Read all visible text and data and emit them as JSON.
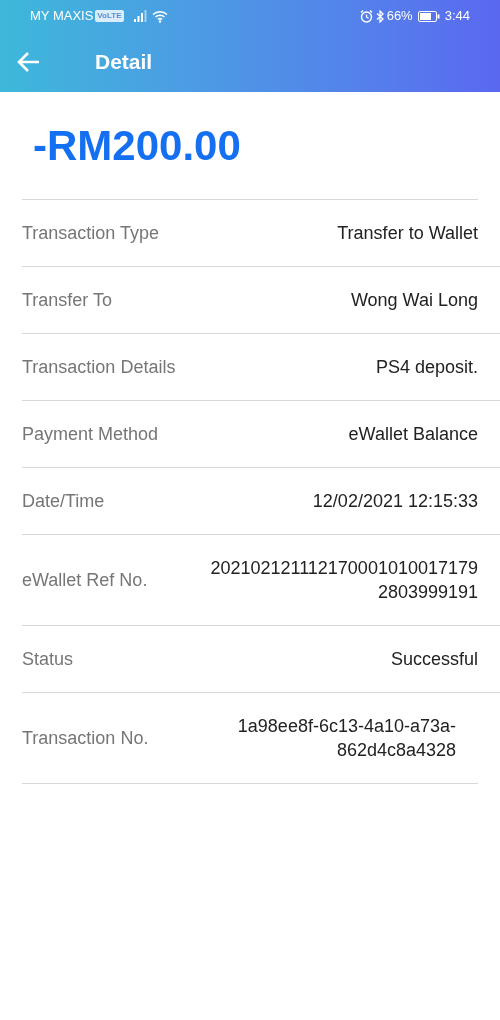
{
  "status_bar": {
    "carrier": "MY MAXIS",
    "network_badge": "VoLTE",
    "battery_percent": "66%",
    "time": "3:44"
  },
  "app_bar": {
    "title": "Detail"
  },
  "amount": "-RM200.00",
  "details": [
    {
      "label": "Transaction Type",
      "value": [
        "Transfer to Wallet"
      ]
    },
    {
      "label": "Transfer To",
      "value": [
        "Wong Wai Long"
      ]
    },
    {
      "label": "Transaction Details",
      "value": [
        "PS4 deposit."
      ]
    },
    {
      "label": "Payment Method",
      "value": [
        "eWallet Balance"
      ]
    },
    {
      "label": "Date/Time",
      "value": [
        "12/02/2021 12:15:33"
      ]
    },
    {
      "label": "eWallet Ref No.",
      "value": [
        "202102121112170001010017179",
        "2803999191"
      ]
    },
    {
      "label": "Status",
      "value": [
        "Successful"
      ]
    },
    {
      "label": "Transaction No.",
      "value": [
        "1a98ee8f-6c13-4a10-a73a-",
        "862d4c8a4328"
      ]
    }
  ]
}
